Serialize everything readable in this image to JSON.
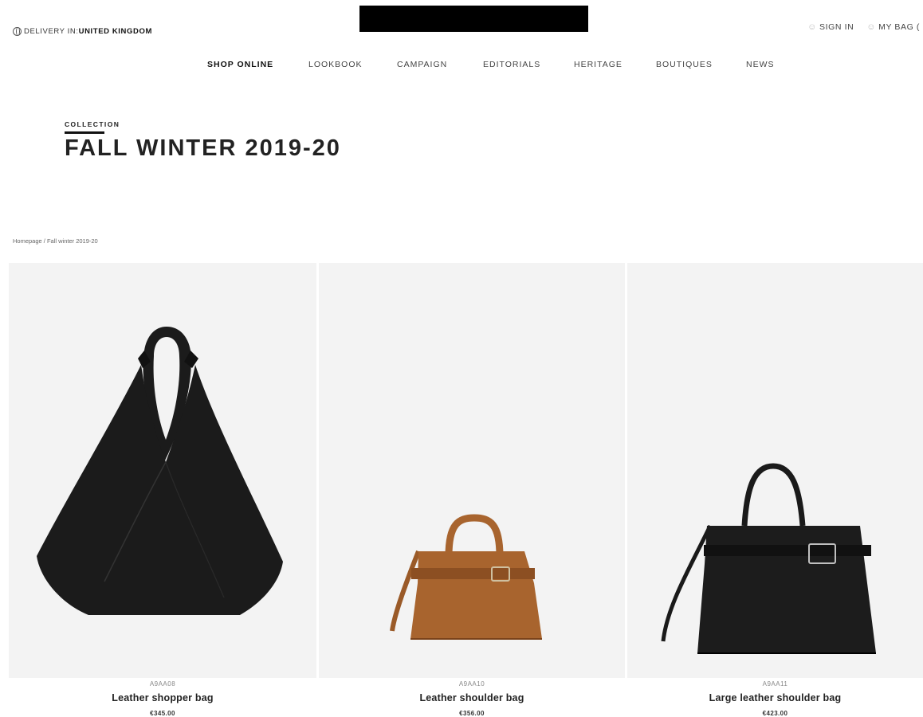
{
  "header": {
    "delivery_label": "DELIVERY IN:",
    "delivery_country": "UNITED KINGDOM",
    "sign_in": "SIGN IN",
    "my_bag": "MY BAG ("
  },
  "nav": {
    "items": [
      "SHOP ONLINE",
      "LOOKBOOK",
      "CAMPAIGN",
      "EDITORIALS",
      "HERITAGE",
      "BOUTIQUES",
      "NEWS"
    ],
    "active": "SHOP ONLINE"
  },
  "collection": {
    "eyebrow": "COLLECTION",
    "title": "FALL WINTER 2019-20"
  },
  "breadcrumb": "Homepage / Fall winter 2019-20",
  "products": [
    {
      "code": "A9AA08",
      "name": "Leather shopper bag",
      "price": "€345.00",
      "color": "#1b1b1b"
    },
    {
      "code": "A9AA10",
      "name": "Leather shoulder bag",
      "price": "€356.00",
      "color": "#a8642e"
    },
    {
      "code": "A9AA11",
      "name": "Large leather shoulder bag",
      "price": "€423.00",
      "color": "#1c1c1c"
    }
  ]
}
